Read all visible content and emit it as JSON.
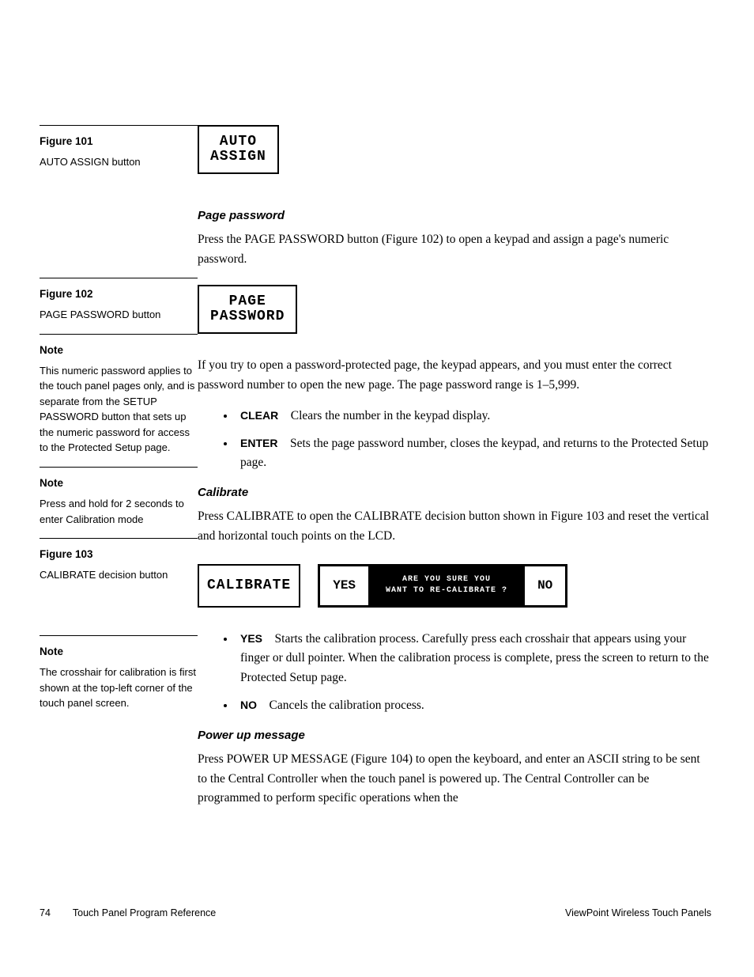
{
  "figures": {
    "f101": {
      "label": "Figure 101",
      "caption": "AUTO ASSIGN button",
      "button_line1": "AUTO",
      "button_line2": "ASSIGN"
    },
    "f102": {
      "label": "Figure 102",
      "caption": "PAGE PASSWORD button",
      "button_line1": "PAGE",
      "button_line2": "PASSWORD"
    },
    "f103": {
      "label": "Figure 103",
      "caption": "CALIBRATE decision button",
      "calibrate": "CALIBRATE",
      "yes": "YES",
      "no": "NO",
      "msg": "ARE YOU SURE YOU\nWANT TO RE-CALIBRATE ?"
    }
  },
  "notes": {
    "n1": {
      "title": "Note",
      "text": "This numeric password applies to the touch panel pages only, and is separate from the SETUP PASSWORD button that sets up the numeric password for access to the Protected Setup page."
    },
    "n2": {
      "title": "Note",
      "text": "Press and hold for 2 seconds to enter Calibration mode"
    },
    "n3": {
      "title": "Note",
      "text": "The crosshair for calibration is first shown at the top-left corner of the touch panel screen."
    }
  },
  "sections": {
    "page_password": {
      "heading": "Page password",
      "p1": "Press the PAGE PASSWORD button (Figure 102) to open a keypad and assign a page's numeric password.",
      "p2": "If you try to open a password-protected page, the keypad appears, and you must enter the correct password number to open the new page. The page password range is 1–5,999.",
      "bullets": [
        {
          "term": "CLEAR",
          "text": "Clears the number in the keypad display."
        },
        {
          "term": "ENTER",
          "text": "Sets the page password number, closes the keypad, and returns to the Protected Setup page."
        }
      ]
    },
    "calibrate": {
      "heading": "Calibrate",
      "p1": "Press CALIBRATE to open the CALIBRATE decision button shown in Figure 103 and reset the vertical and horizontal touch points on the LCD.",
      "bullets": [
        {
          "term": "YES",
          "text": "Starts the calibration process. Carefully press each crosshair that appears using your finger or dull pointer. When the calibration process is complete, press the screen to return to the Protected Setup page."
        },
        {
          "term": "NO",
          "text": "Cancels the calibration process."
        }
      ]
    },
    "power_up": {
      "heading": "Power up message",
      "p1": "Press POWER UP MESSAGE (Figure 104) to open the keyboard, and enter an ASCII string to be sent to the Central Controller when the touch panel is powered up. The Central Controller can be programmed to perform specific operations when the"
    }
  },
  "footer": {
    "page_num": "74",
    "left": "Touch Panel Program Reference",
    "right": "ViewPoint Wireless Touch Panels"
  }
}
